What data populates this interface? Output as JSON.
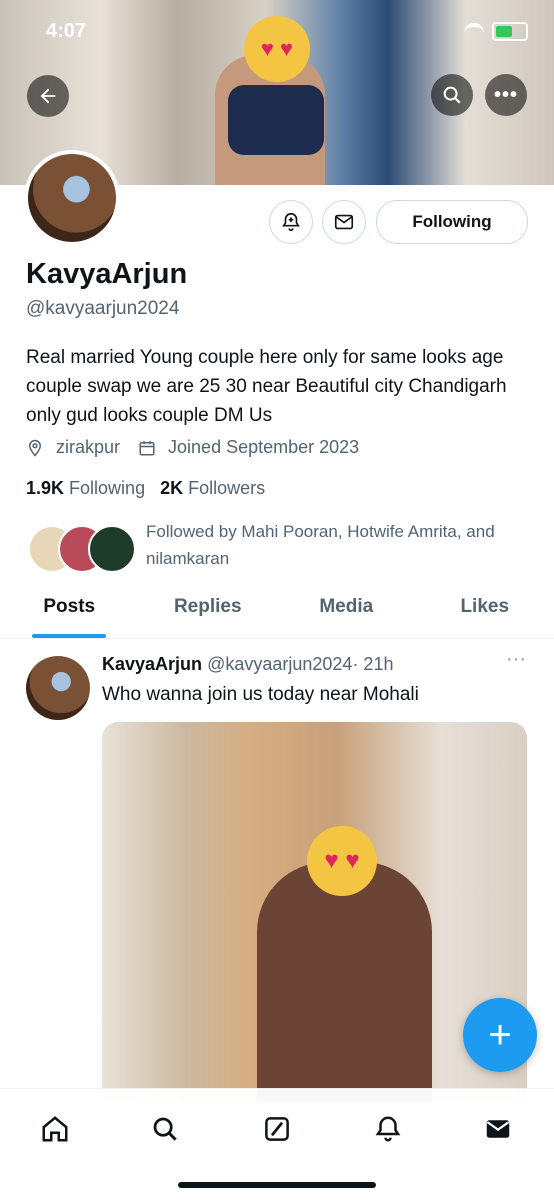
{
  "status_bar": {
    "time": "4:07"
  },
  "profile": {
    "name": "KavyaArjun",
    "handle": "@kavyaarjun2024",
    "bio": "Real married Young couple here only for same looks age couple swap we are 25 30 near Beautiful city Chandigarh only gud looks couple DM Us",
    "location": "zirakpur",
    "joined": "Joined September 2023",
    "following_count": "1.9K",
    "following_label": "Following",
    "followers_count": "2K",
    "followers_label": "Followers",
    "followed_by": "Followed by Mahi Pooran, Hotwife Amrita, and nilamkaran",
    "follow_button": "Following"
  },
  "tabs": [
    {
      "label": "Posts",
      "active": true
    },
    {
      "label": "Replies"
    },
    {
      "label": "Media"
    },
    {
      "label": "Likes"
    }
  ],
  "post": {
    "author": "KavyaArjun",
    "handle": "@kavyaarjun2024",
    "time": "· 21h",
    "text": "Who wanna join us today near Mohali"
  },
  "icons": {
    "back": "back-arrow-icon",
    "search": "search-icon",
    "more": "more-icon",
    "notify": "bell-plus-icon",
    "message": "envelope-icon",
    "compose": "plus-icon"
  },
  "colors": {
    "accent": "#1d9bf0",
    "text": "#0f1419",
    "secondary": "#536471"
  }
}
